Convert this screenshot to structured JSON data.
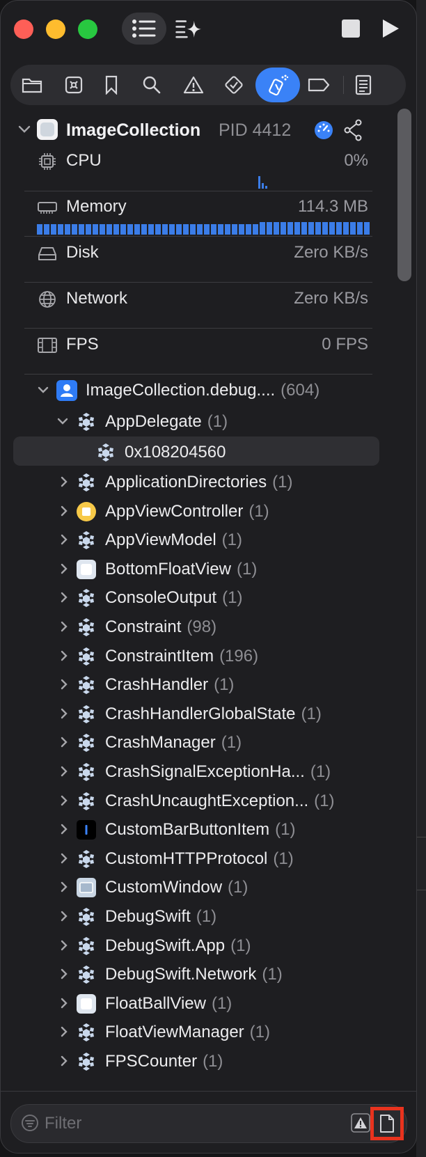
{
  "process": {
    "name": "ImageCollection",
    "pid": "PID 4412"
  },
  "gauges": [
    {
      "label": "CPU",
      "value": "0%",
      "icon": "cpu-icon"
    },
    {
      "label": "Memory",
      "value": "114.3 MB",
      "icon": "memory-icon"
    },
    {
      "label": "Disk",
      "value": "Zero KB/s",
      "icon": "disk-icon"
    },
    {
      "label": "Network",
      "value": "Zero KB/s",
      "icon": "network-icon"
    },
    {
      "label": "FPS",
      "value": "0 FPS",
      "icon": "film-icon"
    }
  ],
  "tree": {
    "root": {
      "name": "ImageCollection.debug....",
      "count": "(604)"
    },
    "app_delegate": {
      "name": "AppDelegate",
      "count": "(1)"
    },
    "instance": {
      "name": "0x108204560"
    },
    "items": [
      {
        "name": "ApplicationDirectories",
        "count": "(1)",
        "icon": "struct"
      },
      {
        "name": "AppViewController",
        "count": "(1)",
        "icon": "yellow"
      },
      {
        "name": "AppViewModel",
        "count": "(1)",
        "icon": "struct"
      },
      {
        "name": "BottomFloatView",
        "count": "(1)",
        "icon": "white"
      },
      {
        "name": "ConsoleOutput",
        "count": "(1)",
        "icon": "struct"
      },
      {
        "name": "Constraint",
        "count": "(98)",
        "icon": "struct"
      },
      {
        "name": "ConstraintItem",
        "count": "(196)",
        "icon": "struct"
      },
      {
        "name": "CrashHandler",
        "count": "(1)",
        "icon": "struct"
      },
      {
        "name": "CrashHandlerGlobalState",
        "count": "(1)",
        "icon": "struct"
      },
      {
        "name": "CrashManager",
        "count": "(1)",
        "icon": "struct"
      },
      {
        "name": "CrashSignalExceptionHa...",
        "count": "(1)",
        "icon": "struct"
      },
      {
        "name": "CrashUncaughtException...",
        "count": "(1)",
        "icon": "struct"
      },
      {
        "name": "CustomBarButtonItem",
        "count": "(1)",
        "icon": "black"
      },
      {
        "name": "CustomHTTPProtocol",
        "count": "(1)",
        "icon": "struct"
      },
      {
        "name": "CustomWindow",
        "count": "(1)",
        "icon": "window"
      },
      {
        "name": "DebugSwift",
        "count": "(1)",
        "icon": "struct"
      },
      {
        "name": "DebugSwift.App",
        "count": "(1)",
        "icon": "struct"
      },
      {
        "name": "DebugSwift.Network",
        "count": "(1)",
        "icon": "struct"
      },
      {
        "name": "FloatBallView",
        "count": "(1)",
        "icon": "white"
      },
      {
        "name": "FloatViewManager",
        "count": "(1)",
        "icon": "struct"
      },
      {
        "name": "FPSCounter",
        "count": "(1)",
        "icon": "struct"
      }
    ]
  },
  "filter": {
    "placeholder": "Filter"
  },
  "colors": {
    "accent": "#3a82f7",
    "highlight": "#e8331e"
  }
}
